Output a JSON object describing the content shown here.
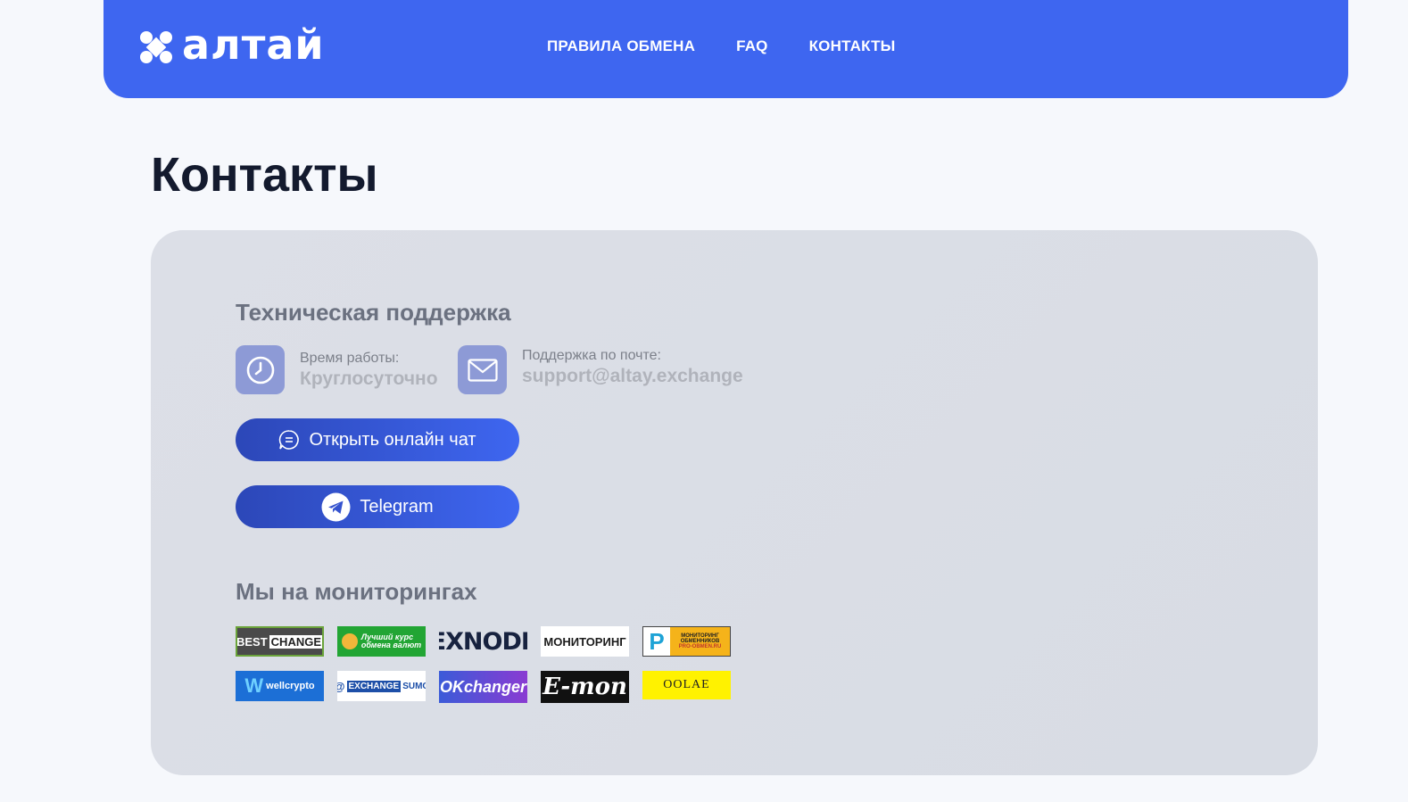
{
  "header": {
    "logo_text": "алтай",
    "nav": [
      "ПРАВИЛА ОБМЕНА",
      "FAQ",
      "КОНТАКТЫ"
    ]
  },
  "page_title": "Контакты",
  "support": {
    "title": "Техническая поддержка",
    "hours_label": "Время работы:",
    "hours_value": "Круглосуточно",
    "email_label": "Поддержка по почте:",
    "email_value": "support@altay.exchange",
    "chat_button": "Открыть онлайн чат",
    "telegram_button": "Telegram"
  },
  "monitorings": {
    "title": "Мы на мониторингах",
    "items": [
      {
        "name": "BEST CHANGE",
        "text_a": "BEST",
        "text_b": "CHANGE"
      },
      {
        "name": "Лучший курс обмена валют",
        "text_a": "Лучший курс",
        "text_b": "обмена валют"
      },
      {
        "name": "EXNODE",
        "text_a": "EXNODE"
      },
      {
        "name": "МОНИТОРИНГ",
        "text_a": "МОНИТОРИНГ"
      },
      {
        "name": "PRO-OBMEN",
        "text_a": "МОНИТОРИНГ",
        "text_b": "ОБМЕННИКОВ",
        "text_c": "PRO-OBMEN.RU"
      },
      {
        "name": "wellcrypto",
        "text_a": "wellcrypto"
      },
      {
        "name": "EXCHANGE SUMO",
        "text_a": "EXCHANGE",
        "text_b": "SUMO"
      },
      {
        "name": "OKchanger",
        "text_a": "OKchanger"
      },
      {
        "name": "E-mon",
        "text_a": "E-mon"
      },
      {
        "name": "OOLAE",
        "text_a": "OOLAE"
      }
    ]
  },
  "colors": {
    "accent": "#3e66f0",
    "background": "#f6f8fc",
    "card": "#dadde5",
    "title": "#131a2e"
  }
}
